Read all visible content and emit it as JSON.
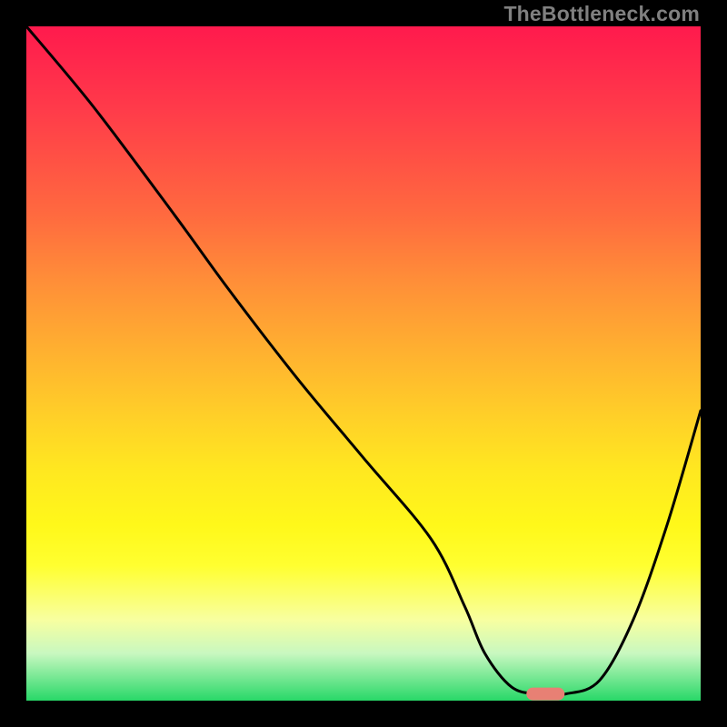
{
  "watermark": "TheBottleneck.com",
  "colors": {
    "frame_border": "#000000",
    "curve_stroke": "#000000",
    "marker_fill": "#e88074",
    "watermark_text": "#808080",
    "gradient_stops": [
      "#ff1a4d",
      "#ffd028",
      "#fff81a",
      "#28d868"
    ]
  },
  "chart_data": {
    "type": "line",
    "title": "",
    "xlabel": "",
    "ylabel": "",
    "xlim": [
      0,
      100
    ],
    "ylim": [
      0,
      100
    ],
    "grid": false,
    "x": [
      0,
      10,
      22,
      30,
      40,
      50,
      60,
      65,
      68,
      72,
      76,
      80,
      85,
      90,
      95,
      100
    ],
    "values": [
      100,
      88,
      72,
      61,
      48,
      36,
      24,
      14,
      7,
      2,
      1,
      1,
      3,
      12,
      26,
      43
    ],
    "curve_description": "Single black curve starting at top-left (value ~100), descending with a gentle kink near x≈22, reaching a trough (value ≈0) around x≈74–80, then rising back up toward the right edge (value ≈43).",
    "marker": {
      "x": 77,
      "y": 1,
      "shape": "capsule",
      "color": "#e88074"
    },
    "marker_description": "Small salmon-colored rounded-rectangle (capsule) marker sitting at the bottom of the trough.",
    "legend": null
  }
}
